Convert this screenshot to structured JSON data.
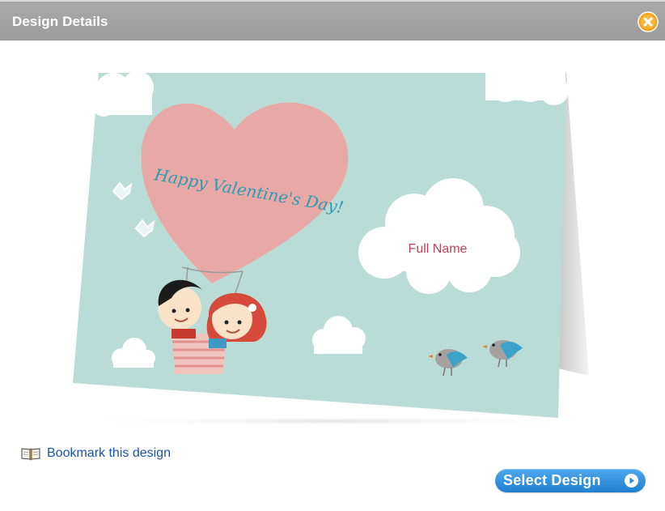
{
  "dialog": {
    "title": "Design Details",
    "close_icon": "close-x-circle-icon"
  },
  "card": {
    "greeting": "Happy Valentine's Day!",
    "name_placeholder": "Full Name",
    "colors": {
      "background": "#b9ddd6",
      "balloon": "#e8a9a6",
      "greeting_text": "#2e9bb2",
      "name_text": "#c0435e"
    }
  },
  "actions": {
    "bookmark_label": "Bookmark this design",
    "bookmark_icon": "open-book-icon",
    "select_label": "Select Design",
    "select_icon": "play-arrow-icon",
    "accent_color": "#2a8ad8"
  }
}
